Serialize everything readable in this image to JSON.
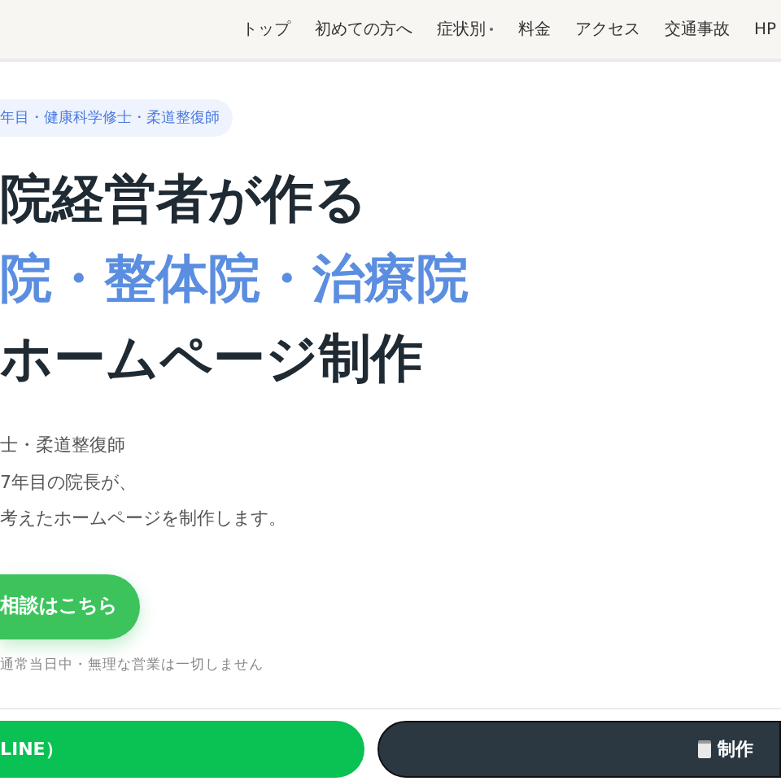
{
  "nav": {
    "items": [
      {
        "label": "トップ",
        "dropdown": false
      },
      {
        "label": "初めての方へ",
        "dropdown": false
      },
      {
        "label": "症状別",
        "dropdown": true
      },
      {
        "label": "料金",
        "dropdown": false
      },
      {
        "label": "アクセス",
        "dropdown": false
      },
      {
        "label": "交通事故",
        "dropdown": false
      },
      {
        "label": "HP",
        "dropdown": false
      }
    ]
  },
  "hero": {
    "badge": "年目・健康科学修士・柔道整復師",
    "headline": [
      {
        "text": "院経営者が作る",
        "accent": false
      },
      {
        "text": "院・整体院・治療院",
        "accent": true
      },
      {
        "text": "ホームページ制作",
        "accent": false
      }
    ],
    "body": [
      "士・柔道整復師",
      "7年目の院長が、",
      "考えたホームページを制作します。"
    ],
    "cta": "相談はこちら",
    "note": "通常当日中・無理な営業は一切しません"
  },
  "bottom_bar": [
    {
      "kind": "line",
      "label": "LINE）"
    },
    {
      "kind": "form",
      "label": "制作"
    }
  ]
}
